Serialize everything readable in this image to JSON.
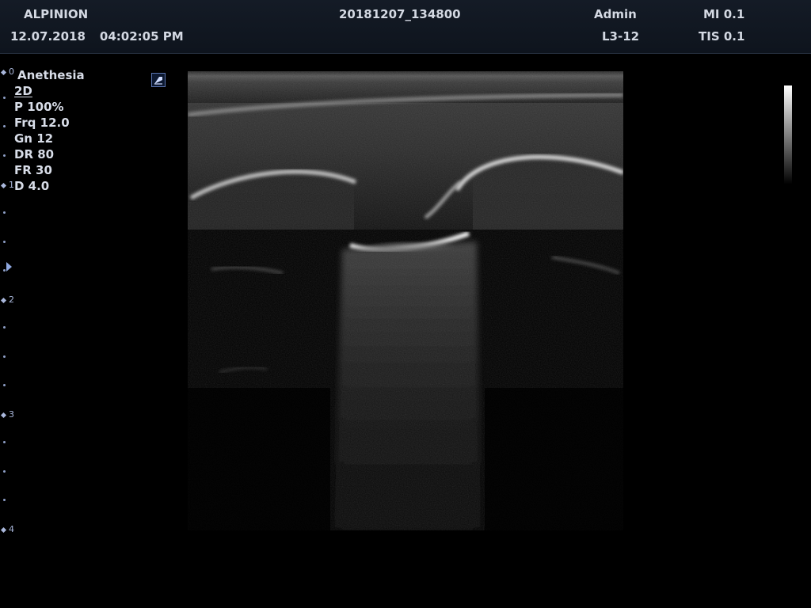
{
  "header": {
    "brand": "ALPINION",
    "date": "12.07.2018",
    "time": "04:02:05 PM",
    "patient_id": "20181207_134800",
    "operator": "Admin",
    "probe": "L3-12",
    "mi": "MI 0.1",
    "tis": "TIS 0.1"
  },
  "params": {
    "preset": "Anethesia",
    "mode": "2D",
    "power": "P 100%",
    "frequency": "Frq 12.0",
    "gain": "Gn 12",
    "dynamic_range": "DR 80",
    "frame_rate": "FR 30",
    "depth": "D 4.0"
  },
  "depth_scale": {
    "labels": [
      "0",
      "1",
      "2",
      "3",
      "4"
    ]
  },
  "icons": {
    "orientation_marker": "probe-orientation-icon",
    "focus_marker": "focus-marker-icon"
  },
  "colors": {
    "header_bg": "#101722",
    "text": "#d4d9e3",
    "scale_accent": "#8fa8e0"
  }
}
